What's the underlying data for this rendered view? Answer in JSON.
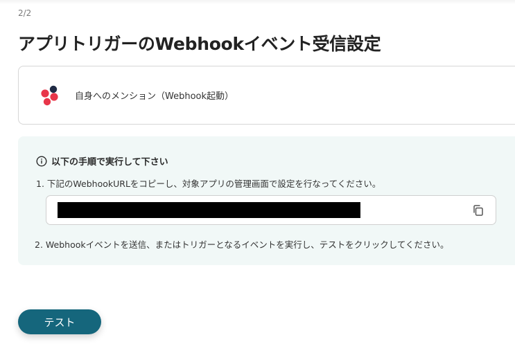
{
  "header": {
    "step_indicator": "2/2",
    "title": "アプリトリガーのWebhookイベント受信設定"
  },
  "app_card": {
    "logo_icon": "yoom-app-logo-icon",
    "label": "自身へのメンション（Webhook起動）"
  },
  "instructions": {
    "info_icon": "info-circle-icon",
    "heading": "以下の手順で実行して下さい",
    "step1": "1. 下記のWebhookURLをコピーし、対象アプリの管理画面で設定を行なってください。",
    "webhook_url": "",
    "copy_icon": "copy-icon",
    "step2": "2. Webhookイベントを送信、またはトリガーとなるイベントを実行し、テストをクリックしてください。"
  },
  "actions": {
    "test_label": "テスト"
  },
  "colors": {
    "accent": "#15667c",
    "info_background": "#f1f8f7",
    "logo_dark": "#1f2a44",
    "logo_red": "#e8364a"
  }
}
